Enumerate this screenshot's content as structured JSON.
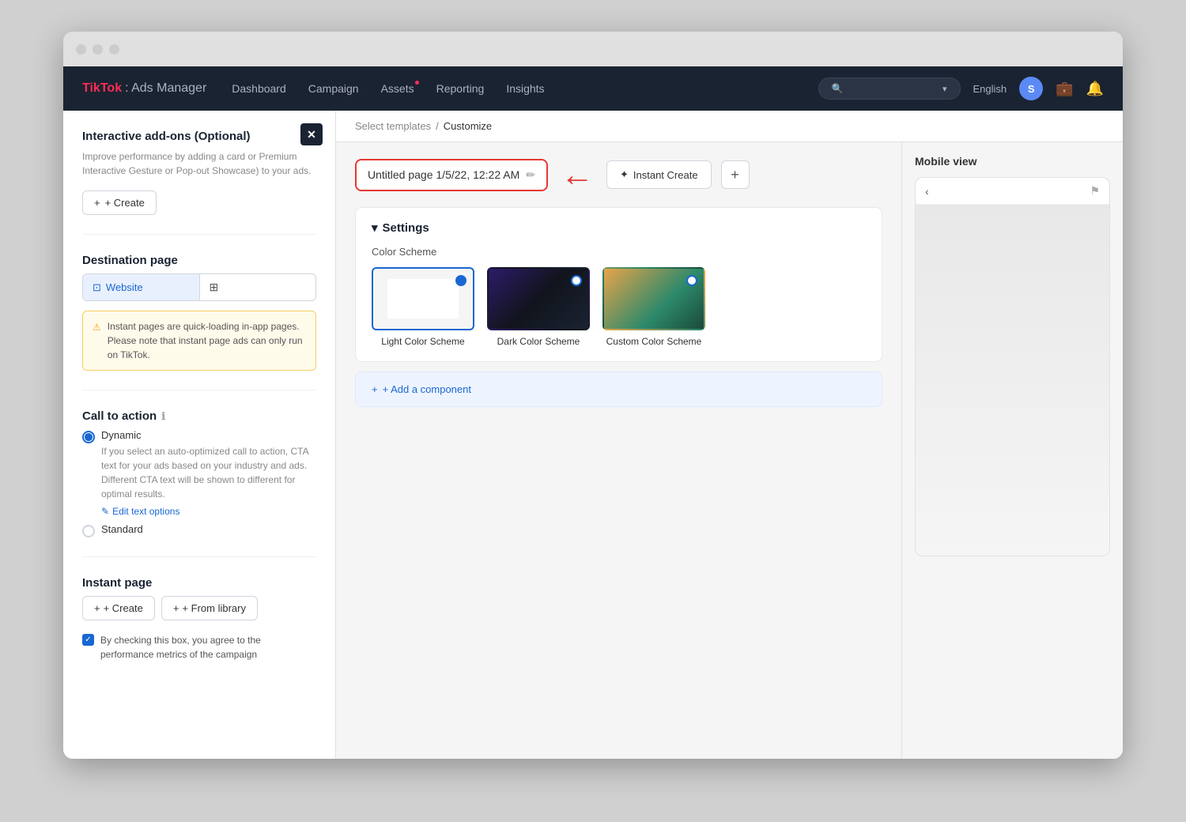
{
  "window": {
    "title": "TikTok Ads Manager"
  },
  "navbar": {
    "brand": "TikTok",
    "brand_sub": ": Ads Manager",
    "links": [
      {
        "label": "Dashboard",
        "dot": false
      },
      {
        "label": "Campaign",
        "dot": false
      },
      {
        "label": "Assets",
        "dot": true
      },
      {
        "label": "Reporting",
        "dot": false
      },
      {
        "label": "Insights",
        "dot": false
      }
    ],
    "lang": "English",
    "avatar": "S",
    "search_placeholder": "Search..."
  },
  "left_panel": {
    "close_label": "✕",
    "interactive_addons_title": "Interactive add-ons (Optional)",
    "interactive_addons_desc": "Improve performance by adding a card or Premium Interactive Gesture or Pop-out Showcase) to your ads.",
    "create_btn": "+ Create",
    "destination_page_title": "Destination page",
    "website_label": "Website",
    "instant_page_info": "Instant pages are quick-loading in-app pages. Please note that instant page ads can only run on TikTok.",
    "cta_title": "Call to action",
    "dynamic_label": "Dynamic",
    "dynamic_desc": "If you select an auto-optimized call to action, CTA text for your ads based on your industry and ads. Different CTA text will be shown to different for optimal results.",
    "edit_text_options_label": "Edit text options",
    "standard_label": "Standard",
    "instant_page_section_title": "Instant page",
    "create_label": "+ Create",
    "from_library_label": "+ From library",
    "checkbox_text": "By checking this box, you agree to the performance metrics of the campaign"
  },
  "breadcrumb": {
    "part1": "Select templates",
    "separator": "/",
    "part2": "Customize"
  },
  "editor": {
    "page_name": "Untitled page 1/5/22, 12:22 AM",
    "instant_create_label": "Instant Create",
    "add_component_label": "+ Add a component",
    "settings_label": "Settings",
    "color_scheme_label": "Color Scheme",
    "schemes": [
      {
        "id": "light",
        "name": "Light Color Scheme",
        "selected": true
      },
      {
        "id": "dark",
        "name": "Dark Color Scheme",
        "selected": false
      },
      {
        "id": "custom",
        "name": "Custom Color Scheme",
        "selected": false
      }
    ]
  },
  "mobile_preview": {
    "title": "Mobile view"
  },
  "icons": {
    "chevron_down": "▾",
    "chevron_left": "‹",
    "flag": "⚑",
    "edit": "✏",
    "monitor": "⊡",
    "grid": "⊞",
    "plus": "+",
    "wand": "✦",
    "info": "ℹ",
    "check": "✓",
    "pencil": "✎"
  }
}
